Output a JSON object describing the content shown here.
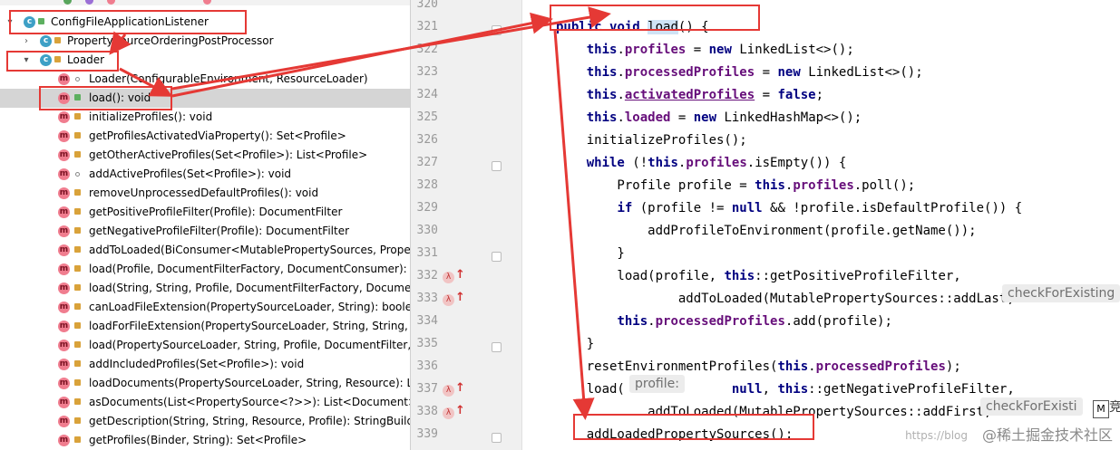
{
  "structure": {
    "items": [
      {
        "label": "ConfigFileApplicationListener",
        "kind": "class",
        "level": 0,
        "expanded": true
      },
      {
        "label": "PropertySourceOrderingPostProcessor",
        "kind": "class",
        "level": 1,
        "expanded": false
      },
      {
        "label": "Loader",
        "kind": "class",
        "level": 1,
        "expanded": true
      },
      {
        "label": "Loader(ConfigurableEnvironment, ResourceLoader)",
        "kind": "method",
        "level": 2
      },
      {
        "label": "load(): void",
        "kind": "method",
        "level": 2,
        "selected": true
      },
      {
        "label": "initializeProfiles(): void",
        "kind": "method",
        "level": 2
      },
      {
        "label": "getProfilesActivatedViaProperty(): Set<Profile>",
        "kind": "method",
        "level": 2
      },
      {
        "label": "getOtherActiveProfiles(Set<Profile>): List<Profile>",
        "kind": "method",
        "level": 2
      },
      {
        "label": "addActiveProfiles(Set<Profile>): void",
        "kind": "method",
        "level": 2
      },
      {
        "label": "removeUnprocessedDefaultProfiles(): void",
        "kind": "method",
        "level": 2
      },
      {
        "label": "getPositiveProfileFilter(Profile): DocumentFilter",
        "kind": "method",
        "level": 2
      },
      {
        "label": "getNegativeProfileFilter(Profile): DocumentFilter",
        "kind": "method",
        "level": 2
      },
      {
        "label": "addToLoaded(BiConsumer<MutablePropertySources, Proper",
        "kind": "method",
        "level": 2
      },
      {
        "label": "load(Profile, DocumentFilterFactory, DocumentConsumer): voi",
        "kind": "method",
        "level": 2
      },
      {
        "label": "load(String, String, Profile, DocumentFilterFactory, DocumentC",
        "kind": "method",
        "level": 2
      },
      {
        "label": "canLoadFileExtension(PropertySourceLoader, String): boolear",
        "kind": "method",
        "level": 2
      },
      {
        "label": "loadForFileExtension(PropertySourceLoader, String, String, Pr",
        "kind": "method",
        "level": 2
      },
      {
        "label": "load(PropertySourceLoader, String, Profile, DocumentFilter, D",
        "kind": "method",
        "level": 2
      },
      {
        "label": "addIncludedProfiles(Set<Profile>): void",
        "kind": "method",
        "level": 2
      },
      {
        "label": "loadDocuments(PropertySourceLoader, String, Resource): List",
        "kind": "method",
        "level": 2
      },
      {
        "label": "asDocuments(List<PropertySource<?>>): List<Document>",
        "kind": "method",
        "level": 2
      },
      {
        "label": "getDescription(String, String, Resource, Profile): StringBuilder",
        "kind": "method",
        "level": 2
      },
      {
        "label": "getProfiles(Binder, String): Set<Profile>",
        "kind": "method",
        "level": 2
      }
    ]
  },
  "editor": {
    "lines": [
      {
        "n": "320",
        "html": ""
      },
      {
        "n": "321",
        "html": "<span class=\"kw\">public</span> <span class=\"kw\">void</span> <span class=\"caret-hl\">load</span>() {"
      },
      {
        "n": "322",
        "html": "    <span class=\"kw\">this</span>.<span class=\"fld\">profiles</span> = <span class=\"kw\">new</span> LinkedList&lt;&gt;();"
      },
      {
        "n": "323",
        "html": "    <span class=\"kw\">this</span>.<span class=\"fld\">processedProfiles</span> = <span class=\"kw\">new</span> LinkedList&lt;&gt;();"
      },
      {
        "n": "324",
        "html": "    <span class=\"kw\">this</span>.<span class=\"fld-ul\">activatedProfiles</span> = <span class=\"kw\">false</span>;"
      },
      {
        "n": "325",
        "html": "    <span class=\"kw\">this</span>.<span class=\"fld\">loaded</span> = <span class=\"kw\">new</span> LinkedHashMap&lt;&gt;();"
      },
      {
        "n": "326",
        "html": "    initializeProfiles();"
      },
      {
        "n": "327",
        "html": "    <span class=\"kw\">while</span> (!<span class=\"kw\">this</span>.<span class=\"fld\">profiles</span>.isEmpty()) {"
      },
      {
        "n": "328",
        "html": "        Profile profile = <span class=\"kw\">this</span>.<span class=\"fld\">profiles</span>.poll();"
      },
      {
        "n": "329",
        "html": "        <span class=\"kw\">if</span> (profile != <span class=\"kw\">null</span> &amp;&amp; !profile.isDefaultProfile()) {"
      },
      {
        "n": "330",
        "html": "            addProfileToEnvironment(profile.getName());"
      },
      {
        "n": "331",
        "html": "        }"
      },
      {
        "n": "332",
        "html": "        load(profile, <span class=\"kw\">this</span>::getPositiveProfileFilter,"
      },
      {
        "n": "333",
        "html": "                addToLoaded(MutablePropertySources::addLast,"
      },
      {
        "n": "334",
        "html": "        <span class=\"kw\">this</span>.<span class=\"fld\">processedProfiles</span>.add(profile);"
      },
      {
        "n": "335",
        "html": "    }"
      },
      {
        "n": "336",
        "html": "    resetEnvironmentProfiles(<span class=\"kw\">this</span>.<span class=\"fld\">processedProfiles</span>);"
      },
      {
        "n": "337",
        "html": "    load(              <span class=\"kw\">null</span>, <span class=\"kw\">this</span>::getNegativeProfileFilter,"
      },
      {
        "n": "338",
        "html": "            addToLoaded(MutablePropertySources::addFirst,"
      },
      {
        "n": "339",
        "html": "    addLoadedPropertySources();"
      }
    ],
    "hints": {
      "check333": "checkForExisting",
      "profile337": "profile:",
      "check338": "checkForExisti"
    },
    "m_badge": "M",
    "tail_char": "竞"
  },
  "watermark": {
    "main": "@稀土掘金技术社区",
    "blog": "https://blog"
  },
  "colors": {
    "annotation_red": "#e53935",
    "selection": "#d5d5d5",
    "keyword": "#000080",
    "field": "#660e7a"
  }
}
